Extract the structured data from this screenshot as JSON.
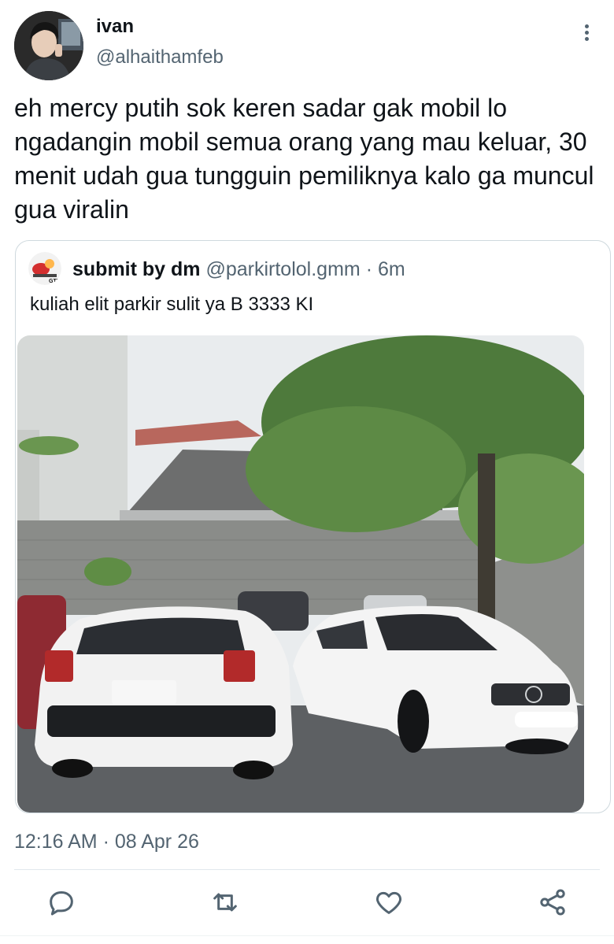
{
  "author": {
    "display_name": "ivan",
    "handle": "@alhaithamfeb",
    "avatar_icon": "profile-photo"
  },
  "tweet": {
    "text": "eh mercy putih sok keren sadar gak mobil lo ngadangin mobil semua orang yang mau keluar, 30 menit udah gua tungguin pemiliknya kalo ga muncul gua viralin",
    "timestamp": "12:16 AM · 08 Apr 26"
  },
  "quoted": {
    "display_name": "submit by dm",
    "handle": "@parkirtolol.gmm",
    "separator": "·",
    "time": "6m",
    "text": "kuliah elit parkir sulit ya B 3333 KI",
    "avatar_badge": "GTM"
  },
  "actions": {
    "reply_icon": "reply-icon",
    "retweet_icon": "retweet-icon",
    "like_icon": "like-icon",
    "share_icon": "share-icon"
  },
  "colors": {
    "text": "#0f1419",
    "secondary": "#536471",
    "border": "#cfd9de",
    "divider": "#e1e8ed"
  }
}
